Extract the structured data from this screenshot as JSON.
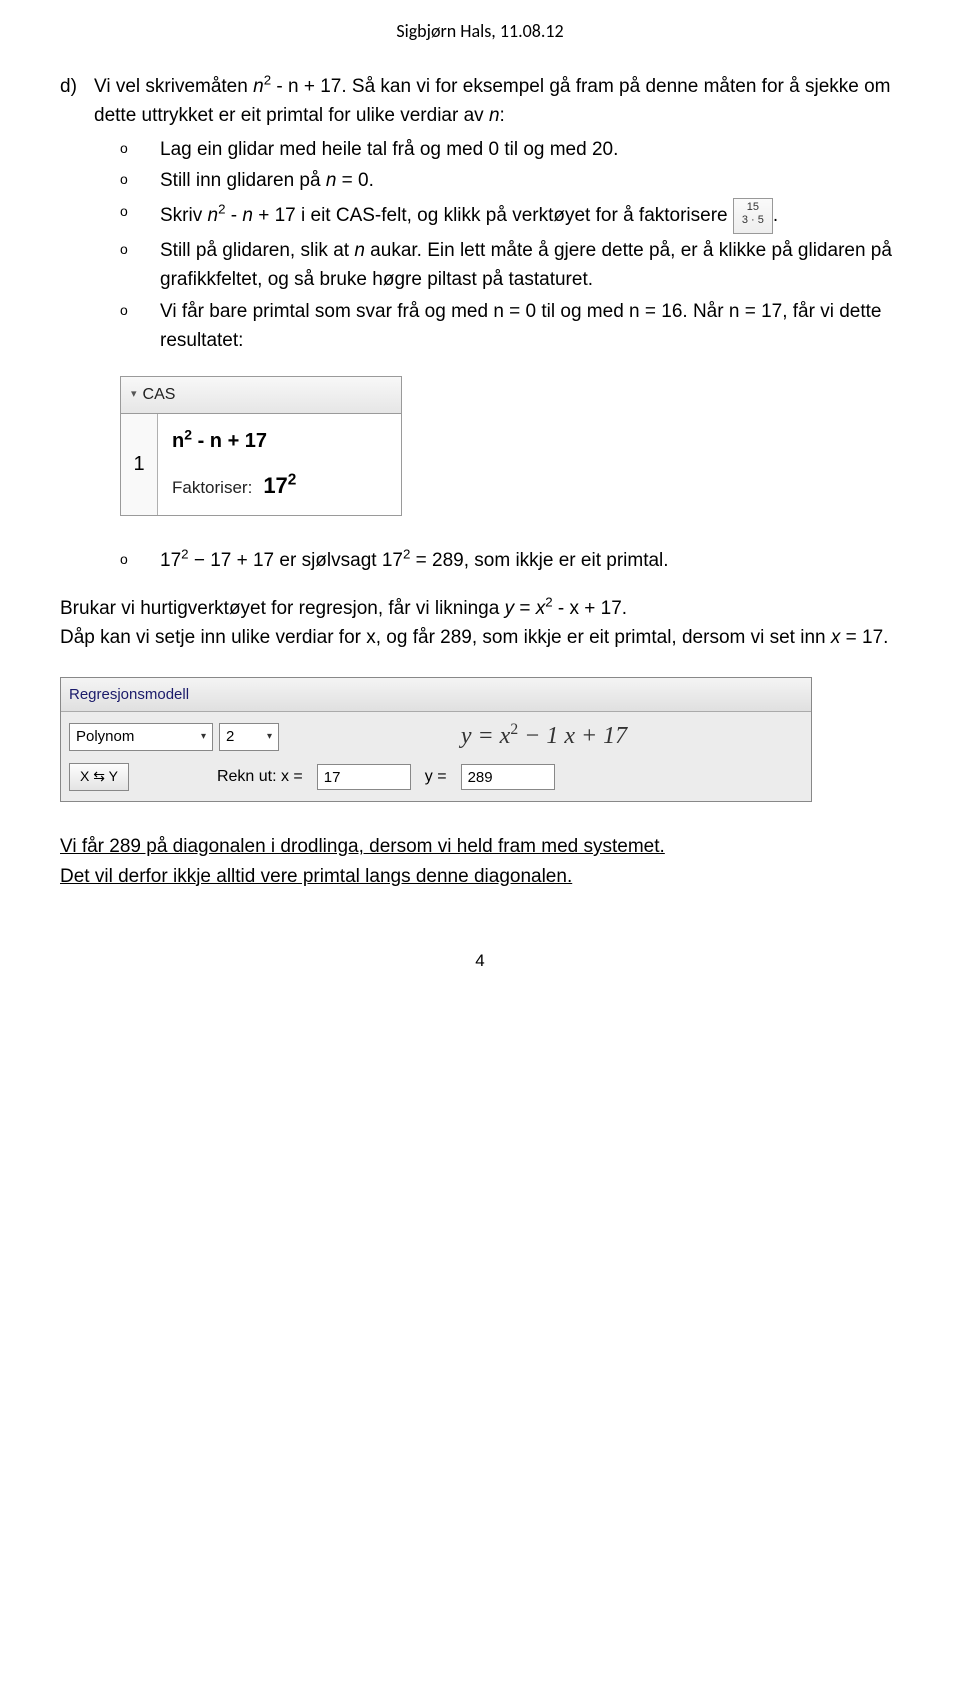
{
  "header": "Sigbjørn Hals, 11.08.12",
  "d_intro": {
    "marker": "d)",
    "pre": "Vi vel skrivemåten ",
    "expr_pre": "n",
    "expr_rest": " - n + 17. Så kan vi for eksempel gå fram på denne måten for å sjekke om dette uttrykket er eit primtal for ulike verdiar av ",
    "n": "n",
    "colon": ":"
  },
  "bullets1": {
    "b1": "Lag ein glidar med heile tal frå og med 0 til og med 20.",
    "b2_pre": "Still inn glidaren på ",
    "b2_n": "n",
    "b2_post": " = 0.",
    "b3_pre": "Skriv ",
    "b3_n": "n",
    "b3_mid": " - ",
    "b3_n2": "n",
    "b3_mid2": " + 17 i eit CAS-felt, og klikk på verktøyet for å faktorisere ",
    "b3_post": ".",
    "b4_pre": "Still på glidaren, slik at ",
    "b4_n": "n",
    "b4_post": " aukar. Ein lett måte å gjere dette på, er å klikke på glidaren på grafikkfeltet, og så bruke høgre piltast på tastaturet.",
    "b5": "Vi får bare primtal som svar frå og med n = 0 til og med n = 16. Når n = 17, får vi dette resultatet:"
  },
  "icon_factor": {
    "line1": "15",
    "line2": "3 · 5"
  },
  "cas": {
    "tab": "CAS",
    "row_num": "1",
    "input_n": "n",
    "input_rest": " - n + 17",
    "out_label": "Faktoriser:",
    "out_val_base": "17",
    "out_val_exp": "2"
  },
  "bullets2": {
    "pre": "17",
    "mid1": " − 17 + 17  er sjølvsagt 17",
    "mid2": " = 289, som ikkje er eit primtal."
  },
  "para2": {
    "l1_pre": "Brukar vi hurtigverktøyet for regresjon, får vi likninga ",
    "l1_y": "y",
    "l1_eq": " = ",
    "l1_x": "x",
    "l1_rest": " - x + 17.",
    "l2_pre": "Dåp kan vi setje inn ulike verdiar for x, og får 289, som ikkje er eit primtal, dersom vi set inn ",
    "l2_x": "x",
    "l2_post": " = 17."
  },
  "regress": {
    "title": "Regresjonsmodell",
    "sel1": "Polynom",
    "sel2": "2",
    "formula": "y = x² − 1 x + 17",
    "btn": "X ⇆ Y",
    "calc_label": "Rekn ut:  x =",
    "x_val": "17",
    "y_lbl": "y =",
    "y_val": "289"
  },
  "concl": {
    "l1": "Vi får 289 på diagonalen i drodlinga, dersom vi held fram med systemet.",
    "l2": "Det vil derfor ikkje alltid vere primtal langs denne diagonalen."
  },
  "page_num": "4"
}
